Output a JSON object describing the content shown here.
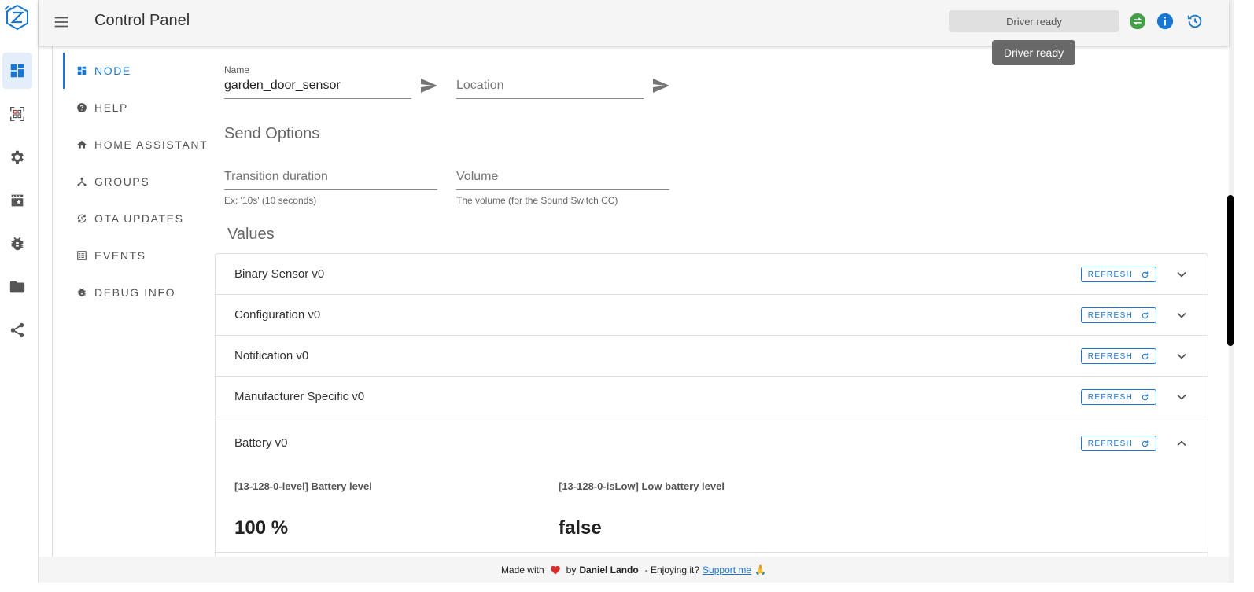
{
  "header": {
    "title": "Control Panel",
    "status": "Driver ready",
    "tooltip": "Driver ready"
  },
  "rail": {
    "icons": [
      "dashboard-icon",
      "qr-scan-icon",
      "settings-icon",
      "scenes-icon",
      "debug-bug-icon",
      "folder-icon",
      "share-icon"
    ]
  },
  "subnav": {
    "items": [
      {
        "label": "NODE",
        "icon": "dashboard-icon"
      },
      {
        "label": "HELP",
        "icon": "help-icon"
      },
      {
        "label": "HOME ASSISTANT",
        "icon": "home-icon"
      },
      {
        "label": "GROUPS",
        "icon": "groups-icon"
      },
      {
        "label": "OTA UPDATES",
        "icon": "ota-update-icon"
      },
      {
        "label": "EVENTS",
        "icon": "events-icon"
      },
      {
        "label": "DEBUG INFO",
        "icon": "debug-bug-icon"
      }
    ]
  },
  "node": {
    "name_label": "Name",
    "name_value": "garden_door_sensor",
    "location_placeholder": "Location"
  },
  "send_options": {
    "title": "Send Options",
    "transition_placeholder": "Transition duration",
    "transition_hint": "Ex: '10s' (10 seconds)",
    "volume_placeholder": "Volume",
    "volume_hint": "The volume (for the Sound Switch CC)"
  },
  "values": {
    "title": "Values",
    "refresh_label": "REFRESH",
    "rows": [
      {
        "label": "Binary Sensor v0",
        "expanded": false
      },
      {
        "label": "Configuration v0",
        "expanded": false
      },
      {
        "label": "Notification v0",
        "expanded": false
      },
      {
        "label": "Manufacturer Specific v0",
        "expanded": false
      },
      {
        "label": "Battery v0",
        "expanded": true
      }
    ],
    "battery": {
      "level_label": "[13-128-0-level] Battery level",
      "level_value": "100 %",
      "islow_label": "[13-128-0-isLow] Low battery level",
      "islow_value": "false"
    }
  },
  "footer": {
    "made_with": "Made with",
    "by": "by",
    "author": "Daniel Lando",
    "enjoying": "- Enjoying it?",
    "support": "Support me",
    "emoji": "🙏"
  },
  "colors": {
    "accent": "#1976d2",
    "status_green": "#43a047"
  }
}
